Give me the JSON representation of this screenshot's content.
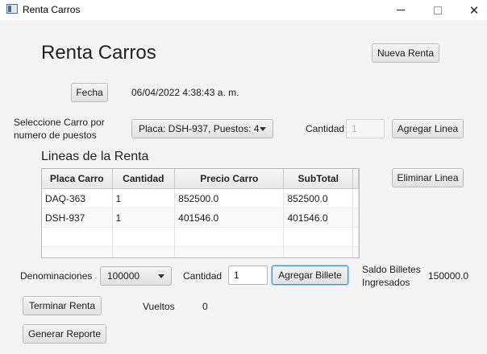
{
  "window": {
    "title": "Renta Carros",
    "min_glyph": "—",
    "max_glyph": "☐",
    "close_glyph": "✕"
  },
  "header": {
    "title": "Renta Carros",
    "new_rental_label": "Nueva Renta"
  },
  "date": {
    "button_label": "Fecha",
    "value": "06/04/2022 4:38:43 a. m."
  },
  "car_selection": {
    "label_line1": "Seleccione Carro por",
    "label_line2": "numero de puestos",
    "selected": "Placa: DSH-937, Puestos: 4",
    "quantity_label": "Cantidad",
    "quantity_placeholder": "1",
    "add_line_label": "Agregar Linea"
  },
  "lines": {
    "title": "Lineas de la Renta",
    "delete_line_label": "Eliminar Linea",
    "columns": [
      "Placa Carro",
      "Cantidad",
      "Precio Carro",
      "SubTotal"
    ],
    "rows": [
      [
        "DAQ-363",
        "1",
        "852500.0",
        "852500.0"
      ],
      [
        "DSH-937",
        "1",
        "401546.0",
        "401546.0"
      ]
    ]
  },
  "payment": {
    "denominations_label": "Denominaciones",
    "denomination_selected": "100000",
    "quantity_label": "Cantidad",
    "quantity_value": "1",
    "add_bill_label": "Agregar Billete",
    "balance_label_line1": "Saldo Billetes",
    "balance_label_line2": "Ingresados",
    "balance_value": "150000.0"
  },
  "footer": {
    "finish_label": "Terminar Renta",
    "change_label": "Vueltos",
    "change_value": "0",
    "report_label": "Generar Reporte"
  },
  "colors": {
    "accent_focus": "#3f8fd6",
    "background": "#f4f4f4"
  }
}
